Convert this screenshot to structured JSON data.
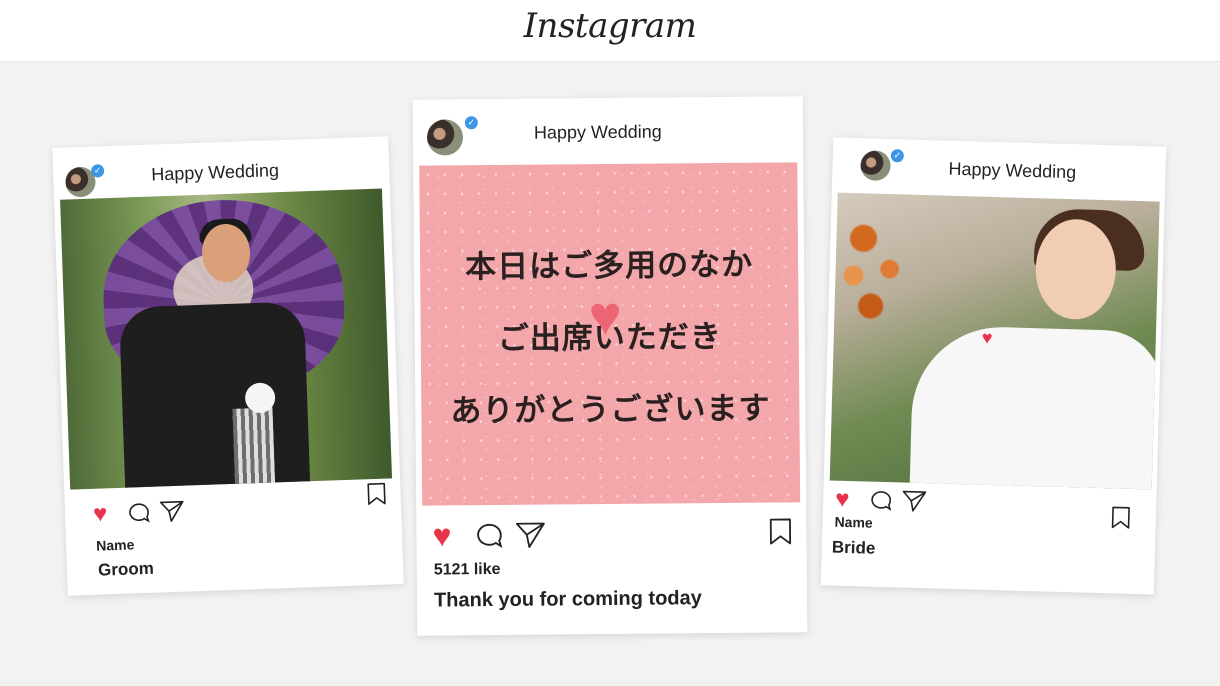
{
  "app": {
    "name": "Instagram"
  },
  "posts": {
    "left": {
      "title": "Happy Wedding",
      "username_label": "Name",
      "caption": "Groom",
      "liked": true
    },
    "center": {
      "title": "Happy Wedding",
      "message_lines": [
        "本日はご多用のなか",
        "ご出席いただき",
        "ありがとうございます"
      ],
      "likes": "5121 like",
      "caption": "Thank you for coming today",
      "liked": true
    },
    "right": {
      "title": "Happy Wedding",
      "username_label": "Name",
      "caption": "Bride",
      "liked": true
    }
  },
  "colors": {
    "heart": "#e8334a",
    "verified": "#3b97e3",
    "message_bg": "#f3a7ab",
    "page_bg": "#f2f2f2"
  },
  "icons": [
    "heart-icon",
    "comment-icon",
    "share-icon",
    "bookmark-icon",
    "verified-icon"
  ]
}
